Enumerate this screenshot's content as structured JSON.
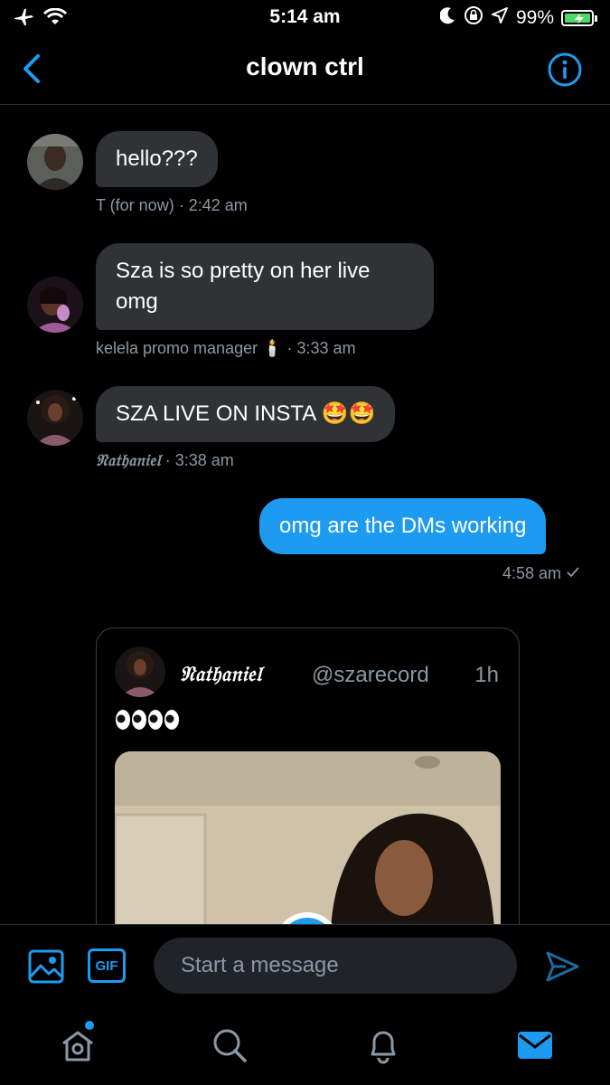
{
  "status_bar": {
    "time": "5:14 am",
    "battery_percent": "99%",
    "icons": [
      "airplane-icon",
      "wifi-icon",
      "moon-icon",
      "orientation-lock-icon",
      "location-icon",
      "battery-charging-icon"
    ]
  },
  "header": {
    "title": "clown ctrl",
    "back_icon": "chevron-left-icon",
    "info_icon": "info-icon"
  },
  "messages": [
    {
      "direction": "in",
      "text": "hello???",
      "sender": "T (for now)",
      "time": "· 2:42 am"
    },
    {
      "direction": "in",
      "text_line1": "Sza is so pretty on her live",
      "text_line2": "omg",
      "sender": "kelela promo manager 🕯️",
      "time": "· 3:33 am"
    },
    {
      "direction": "in",
      "text": "SZA LIVE ON INSTA 🤩🤩",
      "sender": "𝔑𝔞𝔱𝔥𝔞𝔫𝔦𝔢𝔩",
      "time": "· 3:38 am"
    },
    {
      "direction": "out",
      "text": "omg are the DMs working",
      "time": "4:58 am",
      "status_icon": "sent-check-icon"
    }
  ],
  "shared_tweet": {
    "author_name": "𝔑𝔞𝔱𝔥𝔞𝔫𝔦𝔢𝔩",
    "handle": "@szarecord",
    "time": "1h",
    "text": "👀👀"
  },
  "composer": {
    "placeholder": "Start a message",
    "gif_label": "GIF",
    "media_icon": "image-icon",
    "send_icon": "send-icon"
  },
  "tabs": [
    {
      "name": "home",
      "icon": "home-icon",
      "has_notification_dot": true
    },
    {
      "name": "search",
      "icon": "search-icon"
    },
    {
      "name": "notifications",
      "icon": "bell-icon"
    },
    {
      "name": "messages",
      "icon": "mail-icon",
      "active": true
    }
  ],
  "colors": {
    "accent": "#1d9bf0",
    "background": "#000000",
    "bubble_incoming": "#2f3336",
    "secondary_text": "#8b98a5",
    "battery": "#4cd964"
  }
}
